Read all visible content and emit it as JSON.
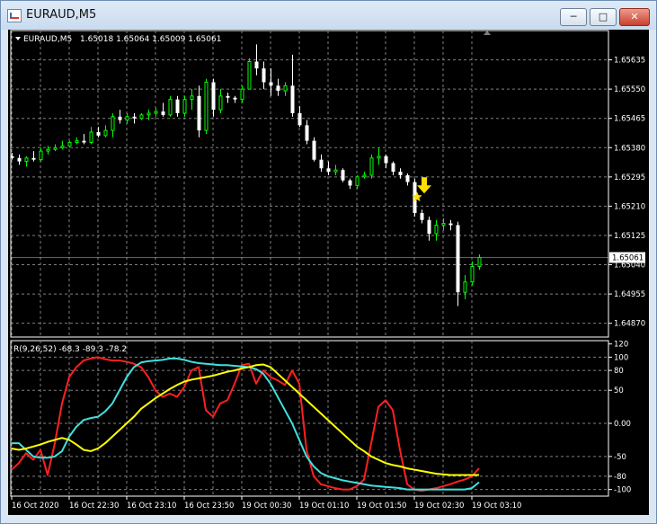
{
  "window": {
    "title": "EURAUD,M5",
    "buttons": {
      "minimize": "─",
      "maximize": "□",
      "close": "✕"
    }
  },
  "colors": {
    "bull": "#00ff00",
    "bear": "#ffffff",
    "signal": "#ffe000",
    "line_red": "#ff2020",
    "line_cyan": "#40e0e0",
    "line_yellow": "#ffff00",
    "grid": "#7f7f7f",
    "tag_bg": "#ffffff"
  },
  "icons": {
    "collapse": "triangle-down-icon",
    "signal_star": "star-icon",
    "signal_arrow": "arrow-down-icon",
    "corner": "triangle-up-icon"
  },
  "chart_data": [
    {
      "type": "candlestick",
      "symbol_label": "EURAUD,M5",
      "ohlc_header": "1.65018 1.65064 1.65009 1.65061",
      "ylim": [
        1.6483,
        1.6572
      ],
      "price_ticks": [
        "1.65635",
        "1.65550",
        "1.65465",
        "1.65380",
        "1.65295",
        "1.65210",
        "1.65125",
        "1.65040",
        "1.64955",
        "1.64870"
      ],
      "price_tick_values": [
        1.65635,
        1.6555,
        1.65465,
        1.6538,
        1.65295,
        1.6521,
        1.65125,
        1.6504,
        1.64955,
        1.6487
      ],
      "current_price_label": "1.65061",
      "current_price": 1.65061,
      "candles": [
        {
          "o": 1.65355,
          "h": 1.65365,
          "l": 1.65345,
          "c": 1.6535
        },
        {
          "o": 1.6535,
          "h": 1.6536,
          "l": 1.6533,
          "c": 1.6534
        },
        {
          "o": 1.6534,
          "h": 1.65355,
          "l": 1.65325,
          "c": 1.6535
        },
        {
          "o": 1.6535,
          "h": 1.6537,
          "l": 1.6534,
          "c": 1.65345
        },
        {
          "o": 1.65345,
          "h": 1.6538,
          "l": 1.6534,
          "c": 1.6537
        },
        {
          "o": 1.6537,
          "h": 1.65385,
          "l": 1.6536,
          "c": 1.65375
        },
        {
          "o": 1.65375,
          "h": 1.6539,
          "l": 1.6537,
          "c": 1.6538
        },
        {
          "o": 1.6538,
          "h": 1.654,
          "l": 1.65375,
          "c": 1.65385
        },
        {
          "o": 1.65385,
          "h": 1.654,
          "l": 1.6538,
          "c": 1.65395
        },
        {
          "o": 1.65395,
          "h": 1.6541,
          "l": 1.6539,
          "c": 1.654
        },
        {
          "o": 1.654,
          "h": 1.6542,
          "l": 1.6539,
          "c": 1.65395
        },
        {
          "o": 1.65395,
          "h": 1.6544,
          "l": 1.6539,
          "c": 1.65425
        },
        {
          "o": 1.65425,
          "h": 1.6544,
          "l": 1.6541,
          "c": 1.65415
        },
        {
          "o": 1.65415,
          "h": 1.65445,
          "l": 1.6541,
          "c": 1.6543
        },
        {
          "o": 1.6543,
          "h": 1.6548,
          "l": 1.6541,
          "c": 1.6547
        },
        {
          "o": 1.6547,
          "h": 1.6549,
          "l": 1.6545,
          "c": 1.6546
        },
        {
          "o": 1.6546,
          "h": 1.6548,
          "l": 1.6545,
          "c": 1.6547
        },
        {
          "o": 1.6547,
          "h": 1.6548,
          "l": 1.6545,
          "c": 1.65465
        },
        {
          "o": 1.65465,
          "h": 1.6548,
          "l": 1.6546,
          "c": 1.65475
        },
        {
          "o": 1.65475,
          "h": 1.6549,
          "l": 1.6546,
          "c": 1.6548
        },
        {
          "o": 1.6548,
          "h": 1.65495,
          "l": 1.6547,
          "c": 1.65485
        },
        {
          "o": 1.65485,
          "h": 1.6551,
          "l": 1.6547,
          "c": 1.65475
        },
        {
          "o": 1.65475,
          "h": 1.6553,
          "l": 1.6547,
          "c": 1.6552
        },
        {
          "o": 1.6552,
          "h": 1.6553,
          "l": 1.6547,
          "c": 1.6548
        },
        {
          "o": 1.6548,
          "h": 1.6553,
          "l": 1.6547,
          "c": 1.6552
        },
        {
          "o": 1.6552,
          "h": 1.6555,
          "l": 1.6549,
          "c": 1.6553
        },
        {
          "o": 1.6553,
          "h": 1.6556,
          "l": 1.6541,
          "c": 1.6543
        },
        {
          "o": 1.6543,
          "h": 1.6558,
          "l": 1.6542,
          "c": 1.6557
        },
        {
          "o": 1.6557,
          "h": 1.6558,
          "l": 1.6547,
          "c": 1.6549
        },
        {
          "o": 1.6549,
          "h": 1.6555,
          "l": 1.6548,
          "c": 1.6553
        },
        {
          "o": 1.6553,
          "h": 1.6554,
          "l": 1.6551,
          "c": 1.65525
        },
        {
          "o": 1.65525,
          "h": 1.6553,
          "l": 1.6551,
          "c": 1.6552
        },
        {
          "o": 1.6552,
          "h": 1.6556,
          "l": 1.6551,
          "c": 1.6555
        },
        {
          "o": 1.6555,
          "h": 1.6564,
          "l": 1.6555,
          "c": 1.6563
        },
        {
          "o": 1.6563,
          "h": 1.6568,
          "l": 1.6559,
          "c": 1.6561
        },
        {
          "o": 1.6561,
          "h": 1.6563,
          "l": 1.6555,
          "c": 1.6557
        },
        {
          "o": 1.6557,
          "h": 1.6561,
          "l": 1.6553,
          "c": 1.6556
        },
        {
          "o": 1.6556,
          "h": 1.6558,
          "l": 1.6553,
          "c": 1.65545
        },
        {
          "o": 1.65545,
          "h": 1.6557,
          "l": 1.6553,
          "c": 1.6556
        },
        {
          "o": 1.6556,
          "h": 1.6565,
          "l": 1.6547,
          "c": 1.6548
        },
        {
          "o": 1.6548,
          "h": 1.655,
          "l": 1.6544,
          "c": 1.65445
        },
        {
          "o": 1.65445,
          "h": 1.6546,
          "l": 1.6539,
          "c": 1.654
        },
        {
          "o": 1.654,
          "h": 1.6541,
          "l": 1.6534,
          "c": 1.65345
        },
        {
          "o": 1.65345,
          "h": 1.6536,
          "l": 1.6531,
          "c": 1.6532
        },
        {
          "o": 1.6532,
          "h": 1.6534,
          "l": 1.653,
          "c": 1.6531
        },
        {
          "o": 1.6531,
          "h": 1.6533,
          "l": 1.653,
          "c": 1.65315
        },
        {
          "o": 1.65315,
          "h": 1.6532,
          "l": 1.6528,
          "c": 1.65285
        },
        {
          "o": 1.65285,
          "h": 1.6529,
          "l": 1.6526,
          "c": 1.6527
        },
        {
          "o": 1.6527,
          "h": 1.653,
          "l": 1.6526,
          "c": 1.65295
        },
        {
          "o": 1.65295,
          "h": 1.6531,
          "l": 1.6529,
          "c": 1.653
        },
        {
          "o": 1.653,
          "h": 1.6536,
          "l": 1.6529,
          "c": 1.6535
        },
        {
          "o": 1.6535,
          "h": 1.6538,
          "l": 1.6533,
          "c": 1.65355
        },
        {
          "o": 1.65355,
          "h": 1.6536,
          "l": 1.6532,
          "c": 1.65335
        },
        {
          "o": 1.65335,
          "h": 1.6534,
          "l": 1.653,
          "c": 1.6531
        },
        {
          "o": 1.6531,
          "h": 1.6532,
          "l": 1.6529,
          "c": 1.653
        },
        {
          "o": 1.653,
          "h": 1.65305,
          "l": 1.6527,
          "c": 1.6528
        },
        {
          "o": 1.6528,
          "h": 1.6529,
          "l": 1.6518,
          "c": 1.6519
        },
        {
          "o": 1.6519,
          "h": 1.652,
          "l": 1.6516,
          "c": 1.6517
        },
        {
          "o": 1.6517,
          "h": 1.6518,
          "l": 1.6511,
          "c": 1.6513
        },
        {
          "o": 1.6513,
          "h": 1.6517,
          "l": 1.6511,
          "c": 1.65155
        },
        {
          "o": 1.65155,
          "h": 1.65175,
          "l": 1.6514,
          "c": 1.6516
        },
        {
          "o": 1.6516,
          "h": 1.6517,
          "l": 1.6514,
          "c": 1.65155
        },
        {
          "o": 1.65155,
          "h": 1.65165,
          "l": 1.6492,
          "c": 1.6496
        },
        {
          "o": 1.6496,
          "h": 1.6501,
          "l": 1.6494,
          "c": 1.6499
        },
        {
          "o": 1.6499,
          "h": 1.6505,
          "l": 1.6498,
          "c": 1.65035
        },
        {
          "o": 1.65035,
          "h": 1.6507,
          "l": 1.65025,
          "c": 1.65061
        }
      ],
      "signal_index": 57
    },
    {
      "type": "line",
      "header_label": "R(9,26,52) -68.3 -89.3 -78.2",
      "ylim": [
        -110,
        125
      ],
      "y_ticks": [
        "120",
        "100",
        "80",
        "50",
        "0.00",
        "-50",
        "-80",
        "-100"
      ],
      "y_tick_values": [
        120,
        100,
        80,
        50,
        0,
        -50,
        -80,
        -100
      ],
      "x_ticks": [
        "16 Oct 2020",
        "16 Oct 22:30",
        "16 Oct 23:10",
        "16 Oct 23:50",
        "19 Oct 00:30",
        "19 Oct 01:10",
        "19 Oct 01:50",
        "19 Oct 02:30",
        "19 Oct 03:10"
      ],
      "x_tick_index": [
        0,
        8,
        16,
        24,
        32,
        40,
        48,
        56,
        64
      ],
      "series": [
        {
          "color": "#ff2020",
          "values": [
            -70,
            -60,
            -45,
            -55,
            -40,
            -78,
            -30,
            30,
            70,
            85,
            95,
            98,
            100,
            97,
            95,
            95,
            93,
            90,
            85,
            70,
            50,
            40,
            45,
            40,
            55,
            80,
            85,
            20,
            10,
            30,
            35,
            60,
            88,
            90,
            60,
            80,
            70,
            65,
            58,
            80,
            60,
            -40,
            -80,
            -92,
            -95,
            -98,
            -100,
            -100,
            -95,
            -85,
            -30,
            25,
            35,
            20,
            -40,
            -92,
            -100,
            -102,
            -100,
            -98,
            -95,
            -92,
            -88,
            -85,
            -80,
            -68
          ]
        },
        {
          "color": "#40e0e0",
          "values": [
            -30,
            -30,
            -40,
            -50,
            -52,
            -52,
            -50,
            -42,
            -20,
            -5,
            5,
            8,
            10,
            18,
            30,
            50,
            70,
            85,
            92,
            94,
            95,
            96,
            98,
            98,
            96,
            93,
            91,
            90,
            89,
            88,
            88,
            87,
            86,
            85,
            82,
            75,
            60,
            40,
            20,
            0,
            -25,
            -50,
            -65,
            -75,
            -80,
            -83,
            -86,
            -88,
            -90,
            -92,
            -94,
            -95,
            -96,
            -97,
            -98,
            -100,
            -100,
            -100,
            -100,
            -100,
            -100,
            -100,
            -100,
            -100,
            -98,
            -89
          ]
        },
        {
          "color": "#ffff00",
          "values": [
            -38,
            -40,
            -38,
            -35,
            -32,
            -28,
            -25,
            -22,
            -25,
            -32,
            -40,
            -42,
            -38,
            -30,
            -20,
            -10,
            0,
            10,
            22,
            30,
            38,
            45,
            52,
            58,
            63,
            66,
            68,
            70,
            72,
            75,
            78,
            80,
            83,
            85,
            88,
            89,
            85,
            75,
            65,
            55,
            45,
            35,
            25,
            15,
            5,
            -5,
            -15,
            -25,
            -35,
            -42,
            -50,
            -55,
            -60,
            -63,
            -65,
            -68,
            -70,
            -72,
            -74,
            -76,
            -77,
            -78,
            -78,
            -78,
            -78,
            -78
          ]
        }
      ]
    }
  ]
}
